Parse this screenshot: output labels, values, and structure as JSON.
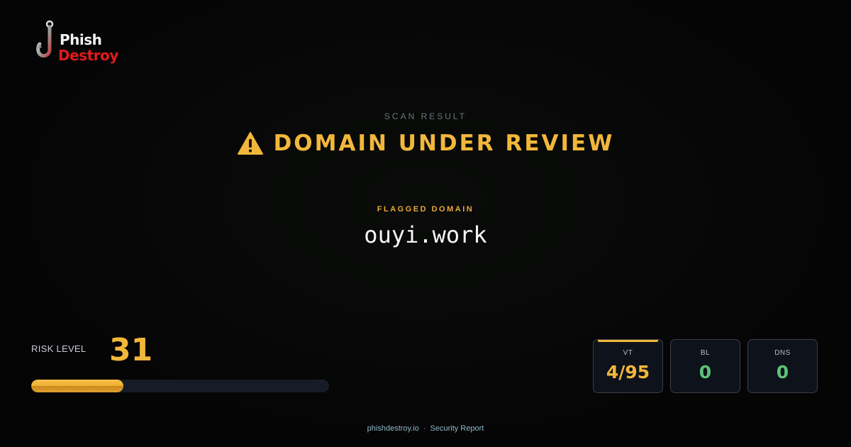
{
  "brand": {
    "line1": "Phish",
    "line2": "Destroy"
  },
  "header": {
    "eyebrow": "SCAN RESULT",
    "status_icon": "warning-triangle-icon",
    "status_title": "DOMAIN UNDER REVIEW"
  },
  "domain": {
    "label": "FLAGGED DOMAIN",
    "value": "ouyi.work"
  },
  "risk": {
    "label": "RISK LEVEL",
    "value": "31",
    "fill_percent": 31
  },
  "stats": [
    {
      "label": "VT",
      "value": "4/95",
      "color": "#f2b73a",
      "highlight": true
    },
    {
      "label": "BL",
      "value": "0",
      "color": "#5cc278",
      "highlight": false
    },
    {
      "label": "DNS",
      "value": "0",
      "color": "#5cc278",
      "highlight": false
    }
  ],
  "footer": {
    "site": "phishdestroy.io",
    "separator": "·",
    "tagline": "Security Report"
  },
  "colors": {
    "accent": "#f2b73a",
    "brand_red": "#e01b1b",
    "safe_green": "#5cc278",
    "background": "#050505"
  }
}
